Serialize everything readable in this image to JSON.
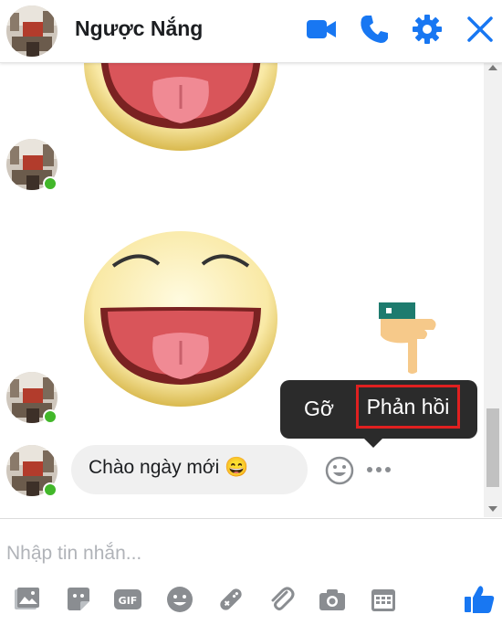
{
  "header": {
    "title": "Ngược Nắng"
  },
  "message": {
    "text": "Chào ngày mới",
    "emoji": "😄"
  },
  "tooltip": {
    "remove_label": "Gỡ",
    "reply_label": "Phản hồi"
  },
  "composer": {
    "placeholder": "Nhập tin nhắn..."
  },
  "colors": {
    "accent": "#1877f2",
    "online": "#42b72a",
    "highlight": "#e02020"
  }
}
